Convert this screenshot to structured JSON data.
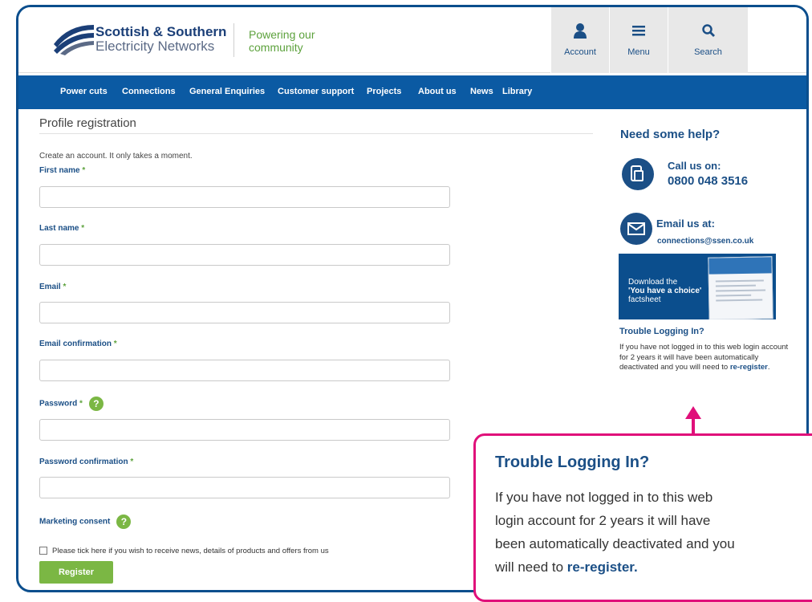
{
  "header": {
    "brand_line1": "Scottish & Southern",
    "brand_line2": "Electricity Networks",
    "tagline_line1": "Powering our",
    "tagline_line2": "community",
    "account_label": "Account",
    "menu_label": "Menu",
    "search_label": "Search"
  },
  "nav": {
    "items": [
      "Power cuts",
      "Connections",
      "General Enquiries",
      "Customer support",
      "Projects",
      "About us",
      "News",
      "Library"
    ]
  },
  "form": {
    "title": "Profile registration",
    "intro": "Create an account. It only takes a moment.",
    "required_marker": "*",
    "fields": {
      "first_name": "First name",
      "last_name": "Last name",
      "email": "Email",
      "email_confirmation": "Email confirmation",
      "password": "Password",
      "password_confirmation": "Password confirmation"
    },
    "marketing_label": "Marketing consent",
    "help_glyph": "?",
    "consent_text": "Please tick here if you wish to receive news, details of products and offers from us",
    "register_label": "Register"
  },
  "sidebar": {
    "help_title": "Need some help?",
    "call_title": "Call us on:",
    "phone": "0800 048 3516",
    "email_title": "Email us at:",
    "email": "connections@ssen.co.uk",
    "promo_line1": "Download the",
    "promo_line2": "'You have a choice'",
    "promo_line3": "factsheet",
    "trouble_title": "Trouble Logging In?",
    "trouble_text": "If you have not logged in to this web login account for 2 years it will have been automatically deactivated and you will need to",
    "trouble_link": "re-register",
    "trouble_end": "."
  },
  "callout": {
    "title": "Trouble Logging In?",
    "line1": "If you have not logged in to this web",
    "line2": "login account for 2 years it will have",
    "line3": "been automatically deactivated and you",
    "line4_prefix": "will need to",
    "link": "re-register."
  },
  "colors": {
    "brand_blue": "#0b5aa3",
    "accent_green": "#7bb744",
    "callout_pink": "#e0107a"
  }
}
